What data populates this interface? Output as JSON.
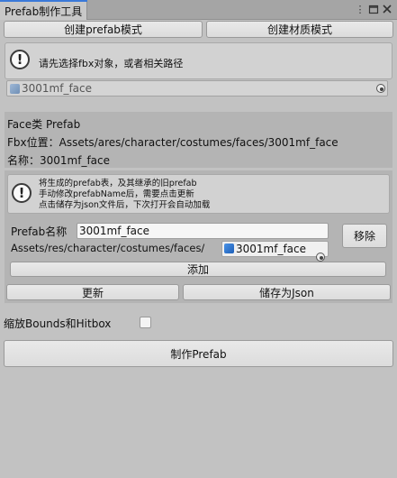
{
  "window": {
    "title": "Prefab制作工具",
    "menu_icon": "kebab-menu-icon",
    "maximize_icon": "maximize-icon",
    "close_icon": "close-icon"
  },
  "modes": {
    "prefab_mode": "创建prefab模式",
    "material_mode": "创建材质模式"
  },
  "notice1": {
    "icon": "warning-icon",
    "text": "请先选择fbx对象，或者相关路径"
  },
  "fbx_field": {
    "value": "3001mf_face",
    "icon": "mesh-cube-icon",
    "picker_icon": "object-picker-icon"
  },
  "info": {
    "face_class": "Face类  Prefab",
    "fbx_location": "Fbx位置：Assets/ares/character/costumes/faces/3001mf_face",
    "name": "名称：3001mf_face"
  },
  "notice2": {
    "icon": "warning-icon",
    "line1": "将生成的prefab表，及其继承的旧prefab",
    "line2": "手动修改prefabName后，需要点击更新",
    "line3": "点击储存为json文件后，下次打开会自动加载"
  },
  "prefab_form": {
    "name_label": "Prefab名称",
    "name_value": "3001mf_face",
    "path_label": "Assets/res/character/costumes/faces/",
    "object_value": "3001mf_face",
    "remove_button": "移除",
    "add_button": "添加",
    "update_button": "更新",
    "save_json_button": "储存为Json"
  },
  "options": {
    "scale_bounds_label": "缩放Bounds和Hitbox",
    "scale_bounds_checked": false
  },
  "actions": {
    "make_prefab": "制作Prefab"
  }
}
